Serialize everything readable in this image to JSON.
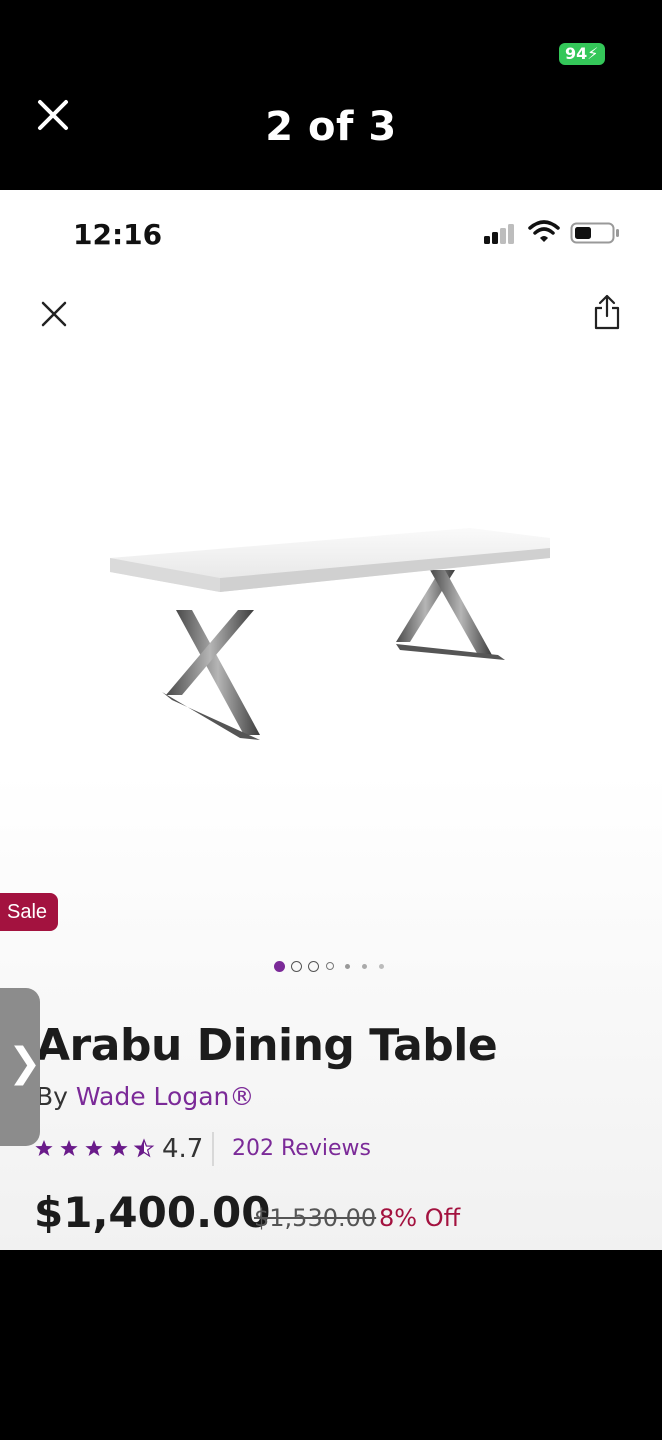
{
  "viewer": {
    "counter": "2 of 3",
    "battery": "94"
  },
  "status_bar": {
    "time": "12:16"
  },
  "product": {
    "badge": "Sale",
    "title": "Arabu Dining Table",
    "by_prefix": "By ",
    "brand": "Wade Logan®",
    "rating": {
      "value": "4.7",
      "stars": 4.5,
      "reviews_label": "202 Reviews"
    },
    "price": {
      "current": "$1,400.00",
      "original": "$1,530.00",
      "discount": "8% Off"
    },
    "image_carousel": {
      "dot_count": 7,
      "active_index": 0
    }
  },
  "colors": {
    "accent_purple": "#7b2a98",
    "sale_red": "#a3123f",
    "battery_green": "#34c759"
  },
  "icons": {
    "viewer_close": "close-icon",
    "close": "close-icon",
    "share": "share-icon",
    "drawer": "chevron-right-icon",
    "star": "star-icon"
  }
}
